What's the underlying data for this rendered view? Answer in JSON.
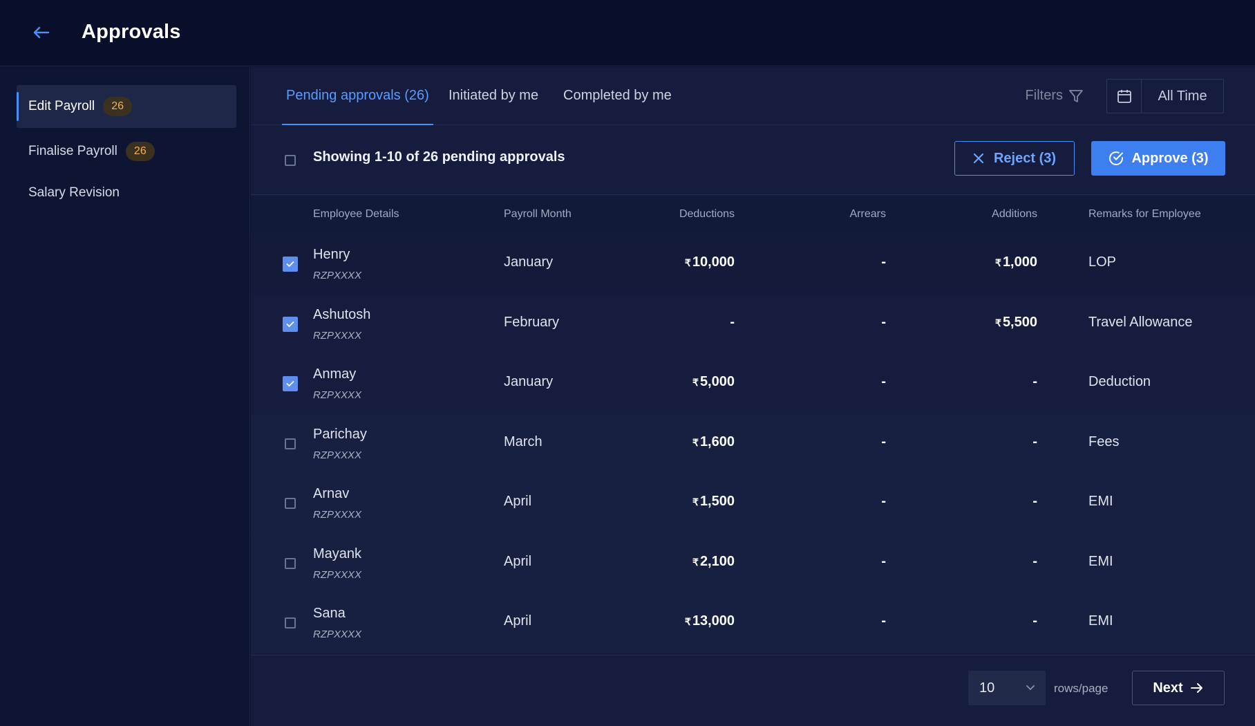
{
  "header": {
    "title": "Approvals"
  },
  "sidebar": {
    "items": [
      {
        "label": "Edit Payroll",
        "badge": "26"
      },
      {
        "label": "Finalise Payroll",
        "badge": "26"
      },
      {
        "label": "Salary Revision"
      }
    ]
  },
  "tabs": [
    {
      "label": "Pending approvals (26)"
    },
    {
      "label": "Initiated by me"
    },
    {
      "label": "Completed by me"
    }
  ],
  "toolbar": {
    "filters_label": "Filters",
    "date_range": "All Time",
    "showing_text": "Showing 1-10 of 26 pending  approvals",
    "reject_label": "Reject (3)",
    "approve_label": "Approve (3)"
  },
  "table": {
    "columns": [
      "Employee Details",
      "Payroll Month",
      "Deductions",
      "Arrears",
      "Additions",
      "Remarks for Employee"
    ],
    "currency_symbol": "₹",
    "rows": [
      {
        "name": "Henry",
        "id": "RZPXXXX",
        "month": "January",
        "deductions": "10,000",
        "arrears": "-",
        "additions": "1,000",
        "remarks": "LOP",
        "checked": true
      },
      {
        "name": "Ashutosh",
        "id": "RZPXXXX",
        "month": "February",
        "deductions": "-",
        "arrears": "-",
        "additions": "5,500",
        "remarks": "Travel Allowance",
        "checked": true
      },
      {
        "name": "Anmay",
        "id": "RZPXXXX",
        "month": "January",
        "deductions": "5,000",
        "arrears": "-",
        "additions": "-",
        "remarks": "Deduction",
        "checked": true
      },
      {
        "name": "Parichay",
        "id": "RZPXXXX",
        "month": "March",
        "deductions": "1,600",
        "arrears": "-",
        "additions": "-",
        "remarks": "Fees",
        "checked": false
      },
      {
        "name": "Arnav",
        "id": "RZPXXXX",
        "month": "April",
        "deductions": "1,500",
        "arrears": "-",
        "additions": "-",
        "remarks": "EMI",
        "checked": false
      },
      {
        "name": "Mayank",
        "id": "RZPXXXX",
        "month": "April",
        "deductions": "2,100",
        "arrears": "-",
        "additions": "-",
        "remarks": "EMI",
        "checked": false
      },
      {
        "name": "Sana",
        "id": "RZPXXXX",
        "month": "April",
        "deductions": "13,000",
        "arrears": "-",
        "additions": "-",
        "remarks": "EMI",
        "checked": false
      }
    ]
  },
  "pagination": {
    "rows_per_page": "10",
    "rows_label": "rows/page",
    "next_label": "Next"
  },
  "colors": {
    "accent": "#4d8df7",
    "badge_text": "#f0b25a",
    "background": "#0b1230"
  },
  "icons": [
    "arrow-left-icon",
    "filter-icon",
    "calendar-icon",
    "close-icon",
    "check-circle-icon",
    "chevron-down-icon",
    "arrow-right-icon",
    "check-icon"
  ]
}
